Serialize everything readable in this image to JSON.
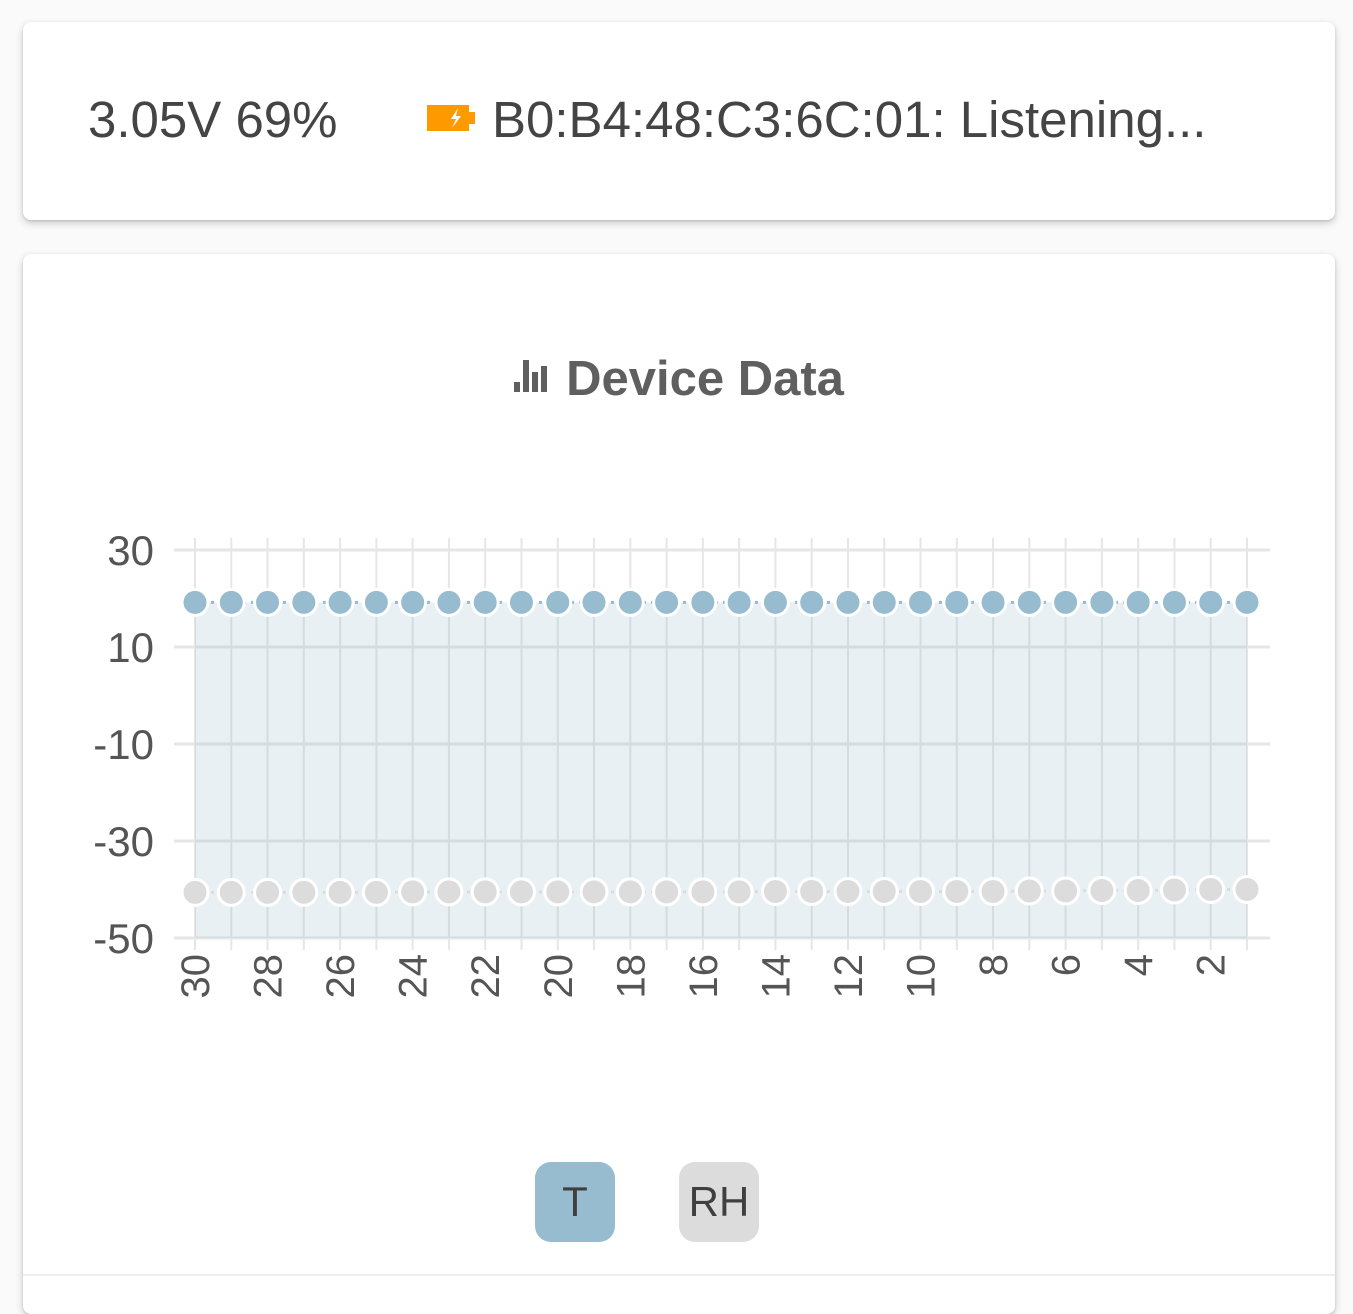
{
  "status": {
    "voltage_text": "3.05V 69%",
    "device_text": "B0:B4:48:C3:6C:01: Listening...",
    "battery_icon": "battery-charging-icon",
    "battery_color": "#ff9900"
  },
  "chart_card": {
    "title": "Device Data",
    "title_icon": "bar-chart-icon"
  },
  "legend": {
    "t_label": "T",
    "rh_label": "RH",
    "t_color": "#97bccf",
    "rh_color": "#dcdcdc"
  },
  "chart_data": {
    "type": "line",
    "x": [
      30,
      29,
      28,
      27,
      26,
      25,
      24,
      23,
      22,
      21,
      20,
      19,
      18,
      17,
      16,
      15,
      14,
      13,
      12,
      11,
      10,
      9,
      8,
      7,
      6,
      5,
      4,
      3,
      2,
      1
    ],
    "x_tick_labels": [
      "30",
      "28",
      "26",
      "24",
      "22",
      "20",
      "18",
      "16",
      "14",
      "12",
      "10",
      "8",
      "6",
      "4",
      "2"
    ],
    "y_ticks": [
      30,
      10,
      -10,
      -30,
      -50
    ],
    "ylim": [
      -50,
      30
    ],
    "grid": true,
    "series": [
      {
        "name": "T",
        "color": "#97bccf",
        "fill": true,
        "values": [
          19.2,
          19.2,
          19.2,
          19.2,
          19.2,
          19.2,
          19.2,
          19.2,
          19.2,
          19.2,
          19.2,
          19.2,
          19.2,
          19.2,
          19.2,
          19.2,
          19.2,
          19.2,
          19.2,
          19.2,
          19.2,
          19.2,
          19.2,
          19.2,
          19.2,
          19.2,
          19.2,
          19.2,
          19.2,
          19.2
        ]
      },
      {
        "name": "RH",
        "color": "#dcdcdc",
        "fill": false,
        "values": [
          -40.6,
          -40.6,
          -40.6,
          -40.6,
          -40.6,
          -40.6,
          -40.5,
          -40.5,
          -40.5,
          -40.5,
          -40.5,
          -40.5,
          -40.5,
          -40.5,
          -40.5,
          -40.5,
          -40.4,
          -40.4,
          -40.4,
          -40.4,
          -40.4,
          -40.4,
          -40.4,
          -40.3,
          -40.3,
          -40.2,
          -40.2,
          -40.1,
          -40.0,
          -40.0
        ]
      }
    ]
  }
}
